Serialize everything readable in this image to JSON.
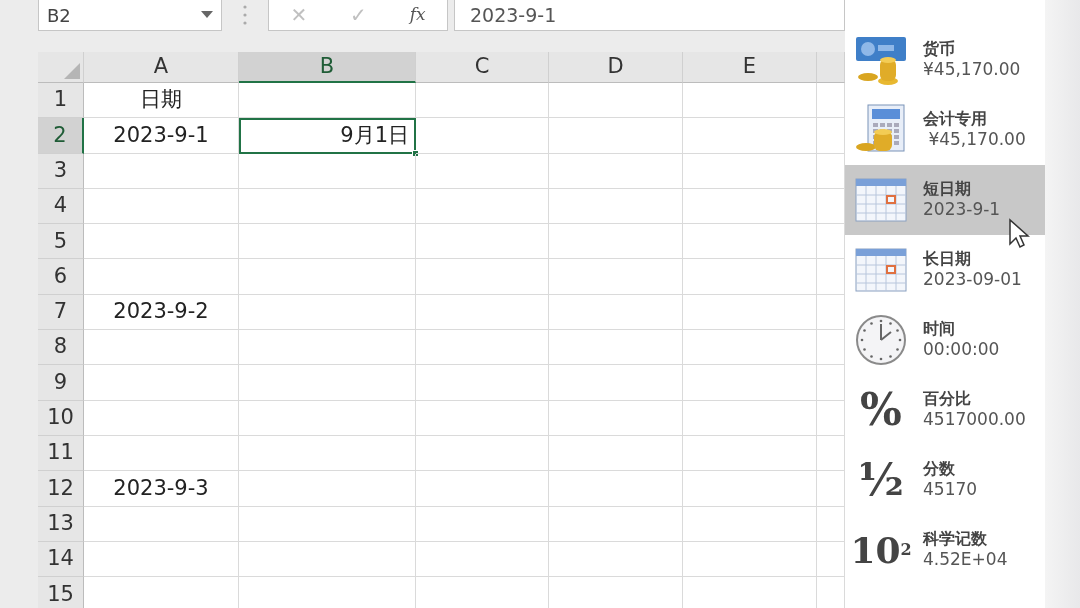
{
  "name_box": {
    "value": "B2"
  },
  "formula_buttons": [
    {
      "symbol": "✕",
      "disabled": true
    },
    {
      "symbol": "✓",
      "disabled": true
    },
    {
      "symbol": "fx"
    }
  ],
  "formula": {
    "value": "2023-9-1"
  },
  "columns": [
    {
      "label": "A",
      "selected": false
    },
    {
      "label": "B",
      "selected": true
    },
    {
      "label": "C",
      "selected": false
    },
    {
      "label": "D",
      "selected": false
    },
    {
      "label": "E",
      "selected": false
    }
  ],
  "rows": [
    {
      "label": "1",
      "selected": false,
      "cells": {
        "A": {
          "text": "日期",
          "selected": false
        }
      }
    },
    {
      "label": "2",
      "selected": true,
      "cells": {
        "A": {
          "text": "2023-9-1",
          "selected": false
        },
        "B": {
          "text": "9月1日",
          "selected": true
        }
      }
    },
    {
      "label": "3",
      "selected": false
    },
    {
      "label": "4",
      "selected": false
    },
    {
      "label": "5",
      "selected": false
    },
    {
      "label": "6",
      "selected": false
    },
    {
      "label": "7",
      "selected": false,
      "cells": {
        "A": {
          "text": "2023-9-2",
          "selected": false
        }
      }
    },
    {
      "label": "8",
      "selected": false
    },
    {
      "label": "9",
      "selected": false
    },
    {
      "label": "10",
      "selected": false
    },
    {
      "label": "11",
      "selected": false
    },
    {
      "label": "12",
      "selected": false,
      "cells": {
        "A": {
          "text": "2023-9-3",
          "selected": false
        }
      }
    },
    {
      "label": "13",
      "selected": false
    },
    {
      "label": "14",
      "selected": false
    },
    {
      "label": "15",
      "selected": false
    }
  ],
  "format_menu": [
    {
      "kind": "currency",
      "label": "货币",
      "sample": "¥45,170.00",
      "selected": false
    },
    {
      "kind": "accounting",
      "label": "会计专用",
      "sample": " ¥45,170.00",
      "selected": false
    },
    {
      "kind": "calendar",
      "label": "短日期",
      "sample": "2023-9-1",
      "selected": true
    },
    {
      "kind": "calendar",
      "label": "长日期",
      "sample": "2023-09-01",
      "selected": false
    },
    {
      "kind": "clock",
      "label": "时间",
      "sample": "00:00:00",
      "selected": false
    },
    {
      "kind": "symbol",
      "symbol": "%",
      "label": "百分比",
      "sample": "4517000.00",
      "selected": false
    },
    {
      "kind": "symbol",
      "symbol": "½",
      "label": "分数",
      "sample": "45170",
      "selected": false
    },
    {
      "kind": "power",
      "symbol": "10",
      "exponent": "2",
      "label": "科学记数",
      "sample": "4.52E+04",
      "selected": false
    }
  ]
}
